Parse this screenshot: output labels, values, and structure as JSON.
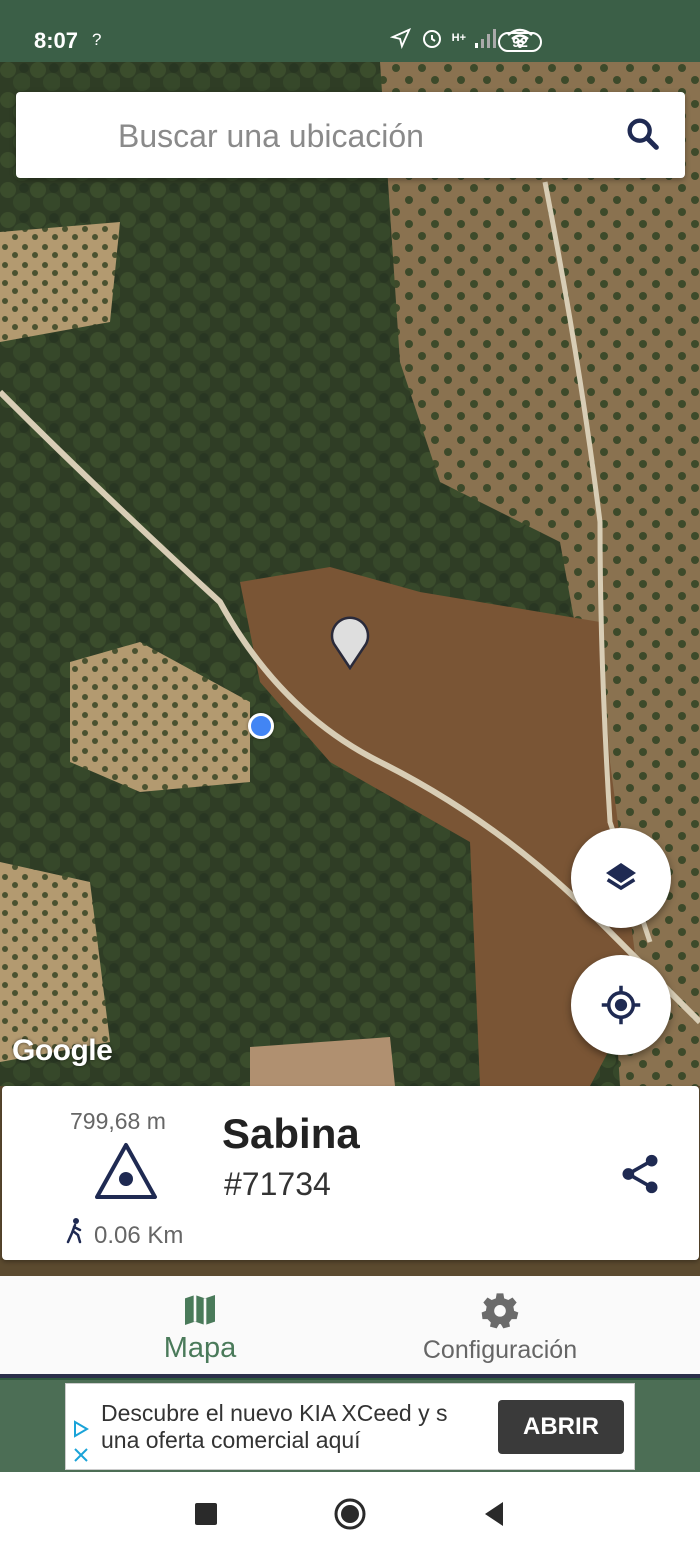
{
  "status_bar": {
    "time": "8:07",
    "left_icon": "?",
    "network": "H+",
    "battery": "92"
  },
  "search": {
    "placeholder": "Buscar una ubicación"
  },
  "map": {
    "attribution": "Google",
    "pin_icon": "map-pin-icon",
    "user_location_icon": "user-location-dot"
  },
  "info_card": {
    "elevation": "799,68 m",
    "distance": "0.06 Km",
    "name": "Sabina",
    "id": "#71734",
    "icon": "triangulation-icon"
  },
  "bottom_nav": {
    "items": [
      {
        "label": "Mapa",
        "icon": "map-icon",
        "active": true
      },
      {
        "label": "Configuración",
        "icon": "gear-icon",
        "active": false
      }
    ]
  },
  "ad": {
    "text": "Descubre el nuevo KIA XCeed y s una oferta comercial aquí",
    "button": "ABRIR"
  },
  "colors": {
    "primary": "#3b5f47",
    "accent": "#4a7a5a",
    "dark_icon": "#1f2a52"
  }
}
